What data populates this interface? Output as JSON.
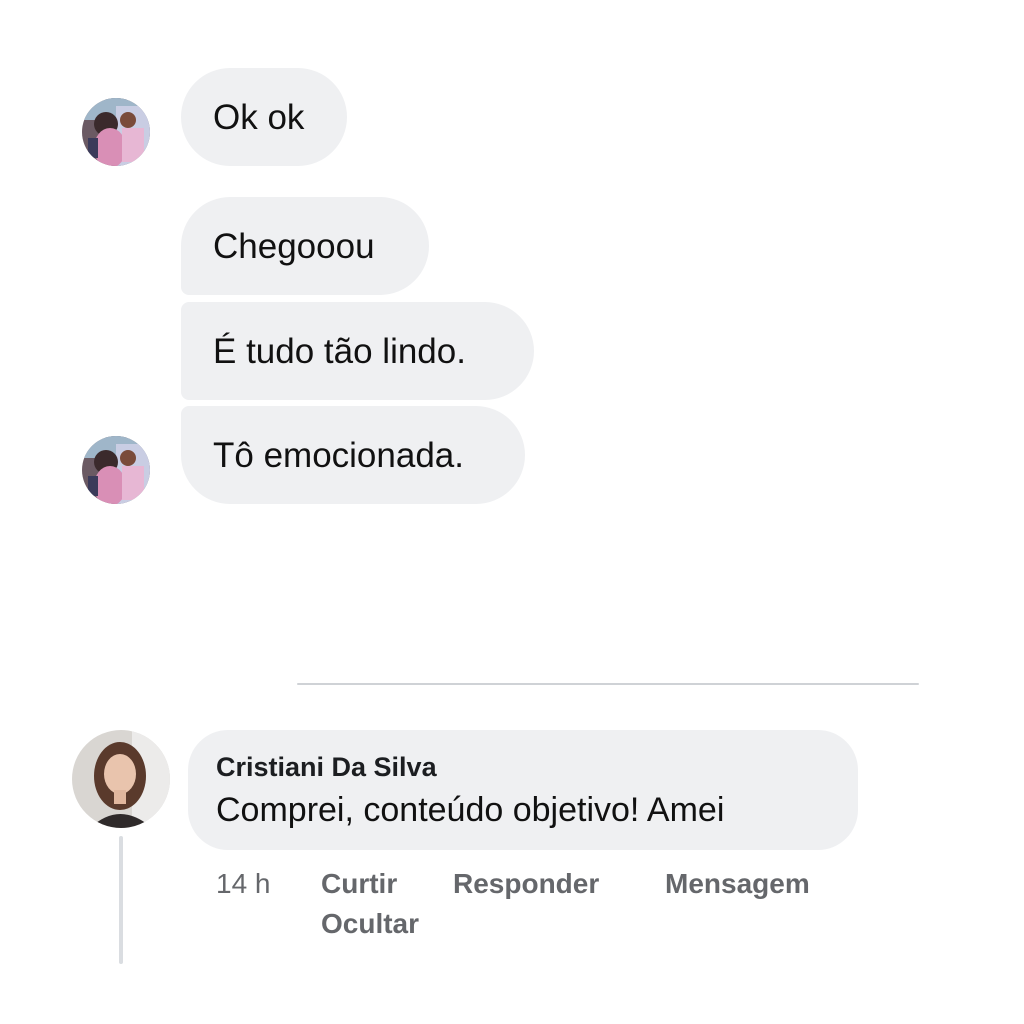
{
  "messages": [
    {
      "text": "Ok ok"
    },
    {
      "text": "Chegooou"
    },
    {
      "text": "É tudo tão lindo."
    },
    {
      "text": "Tô emocionada."
    }
  ],
  "comment": {
    "author": "Cristiani Da Silva",
    "text": "Comprei, conteúdo objetivo! Amei",
    "time": "14 h",
    "actions": {
      "like": "Curtir",
      "reply": "Responder",
      "message": "Mensagem",
      "hide": "Ocultar"
    }
  },
  "colors": {
    "bubble": "#eff0f2",
    "meta_text": "#65676b"
  }
}
